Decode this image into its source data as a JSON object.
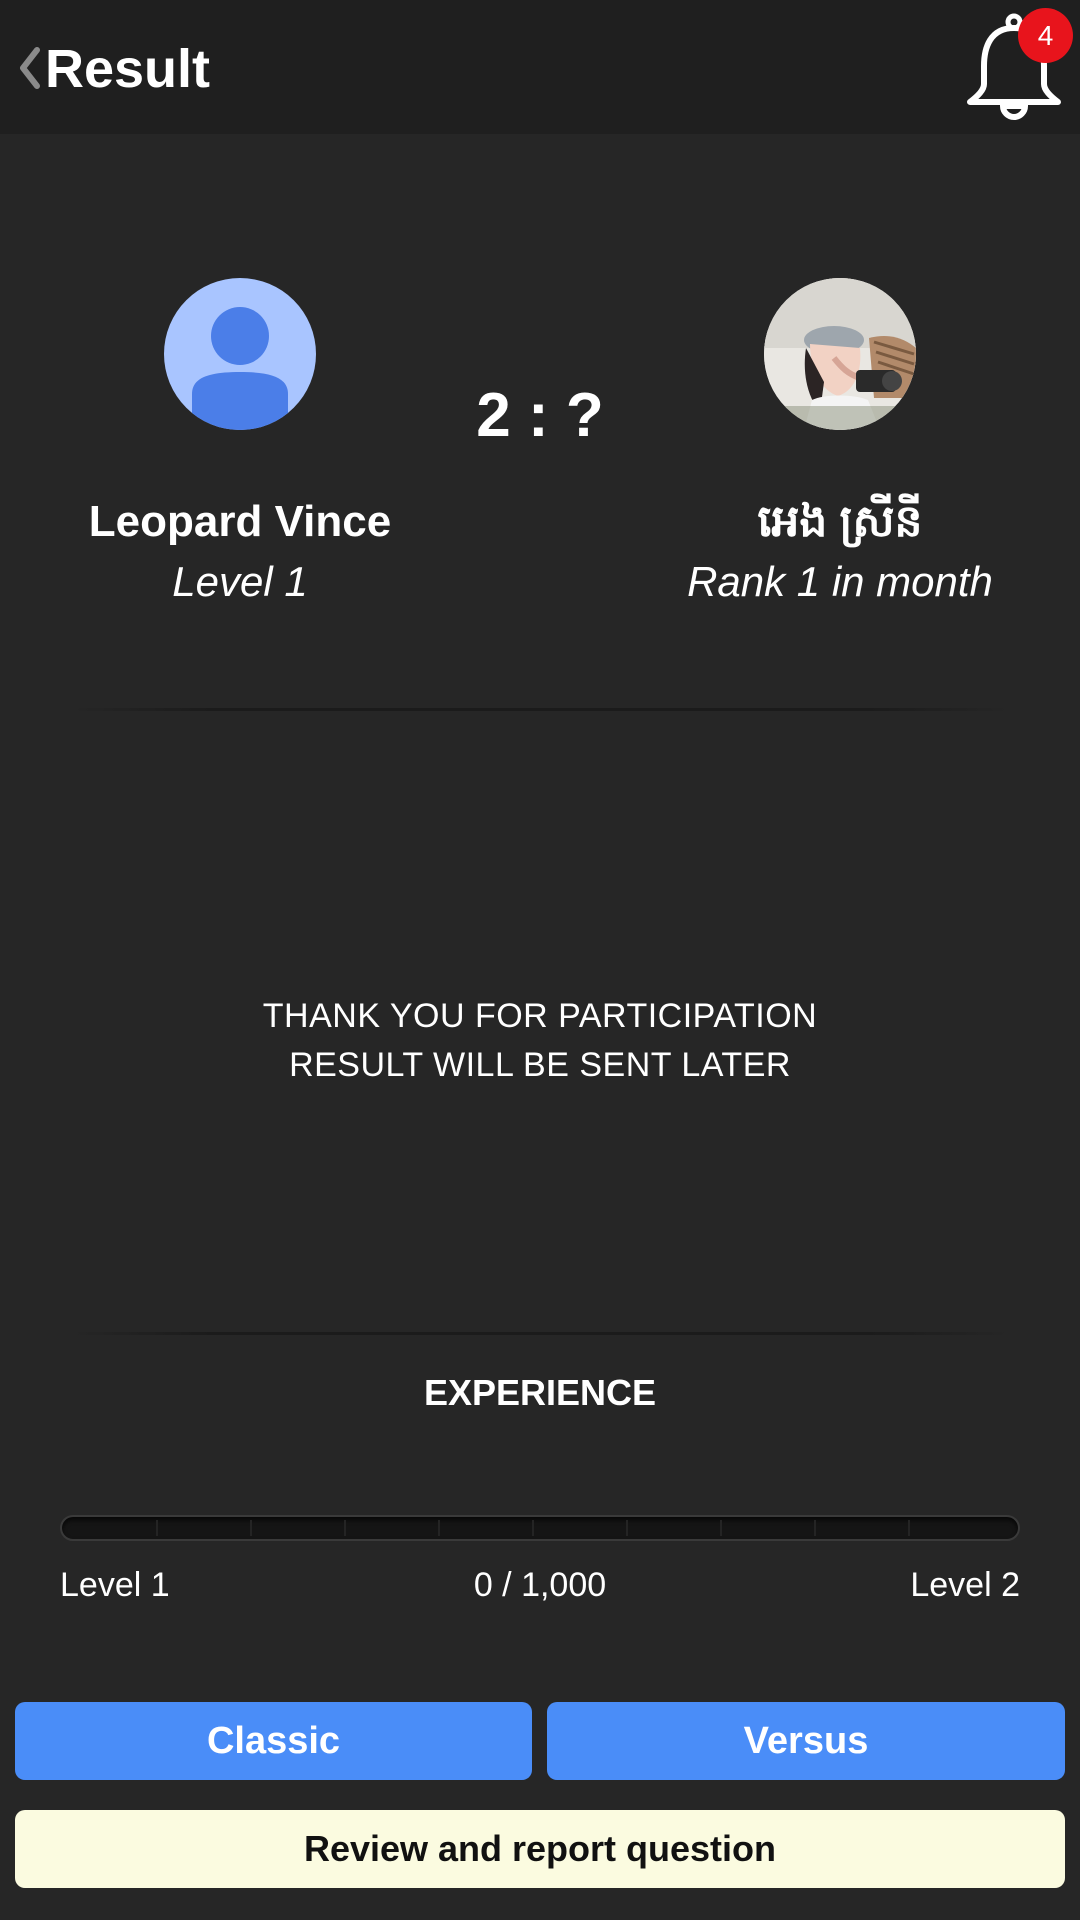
{
  "header": {
    "title": "Result",
    "back_icon": "chevron-left-icon",
    "bell_icon": "bell-icon",
    "notification_count": "4"
  },
  "match": {
    "score": "2 : ?",
    "player": {
      "name": "Leopard Vince",
      "subtitle": "Level 1",
      "avatar": "default-user-icon"
    },
    "opponent": {
      "name": "អេង ស្រីនី",
      "subtitle": "Rank 1 in month",
      "avatar": "user-photo"
    }
  },
  "message": {
    "line1": "THANK YOU FOR PARTICIPATION",
    "line2": "RESULT WILL BE SENT LATER"
  },
  "experience": {
    "title": "EXPERIENCE",
    "current": 0,
    "max": 1000,
    "progress_fraction": 0,
    "progress_text": "0 / 1,000",
    "level_from": "Level 1",
    "level_to": "Level 2"
  },
  "actions": {
    "classic_label": "Classic",
    "versus_label": "Versus",
    "review_label": "Review and report question"
  },
  "colors": {
    "background": "#262626",
    "app_bar": "#1f1f1f",
    "accent_blue": "#4a8df8",
    "badge_red": "#e8141c",
    "review_button": "#fbfbe0"
  }
}
